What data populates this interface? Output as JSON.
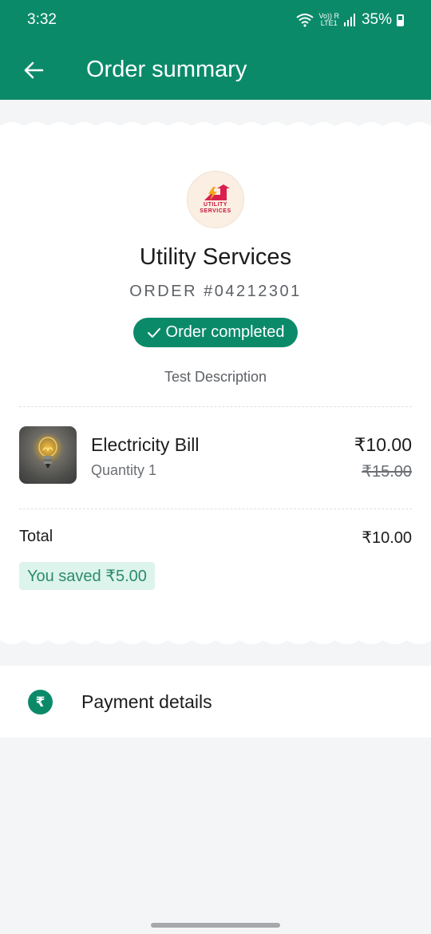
{
  "status_bar": {
    "time": "3:32",
    "network_top": "Vo)) R",
    "network_bottom": "LTE1",
    "battery_percent": "35%",
    "icons": [
      "wifi-icon",
      "signal-icon",
      "battery-icon"
    ]
  },
  "toolbar": {
    "title": "Order summary",
    "back_icon": "arrow-left-icon"
  },
  "merchant": {
    "logo_line1": "UTILITY",
    "logo_line2": "SERVICES",
    "name": "Utility Services",
    "order_number": "ORDER #04212301",
    "status": "Order completed",
    "description": "Test Description"
  },
  "item": {
    "name": "Electricity Bill",
    "quantity": "Quantity 1",
    "price": "₹10.00",
    "original_price": "₹15.00"
  },
  "total": {
    "label": "Total",
    "value": "₹10.00",
    "savings": "You saved ₹5.00"
  },
  "payment": {
    "label": "Payment details",
    "icon": "rupee-icon"
  },
  "colors": {
    "primary": "#0b8a6a",
    "savings_bg": "#dcf4ec",
    "page_bg": "#f4f5f7"
  }
}
